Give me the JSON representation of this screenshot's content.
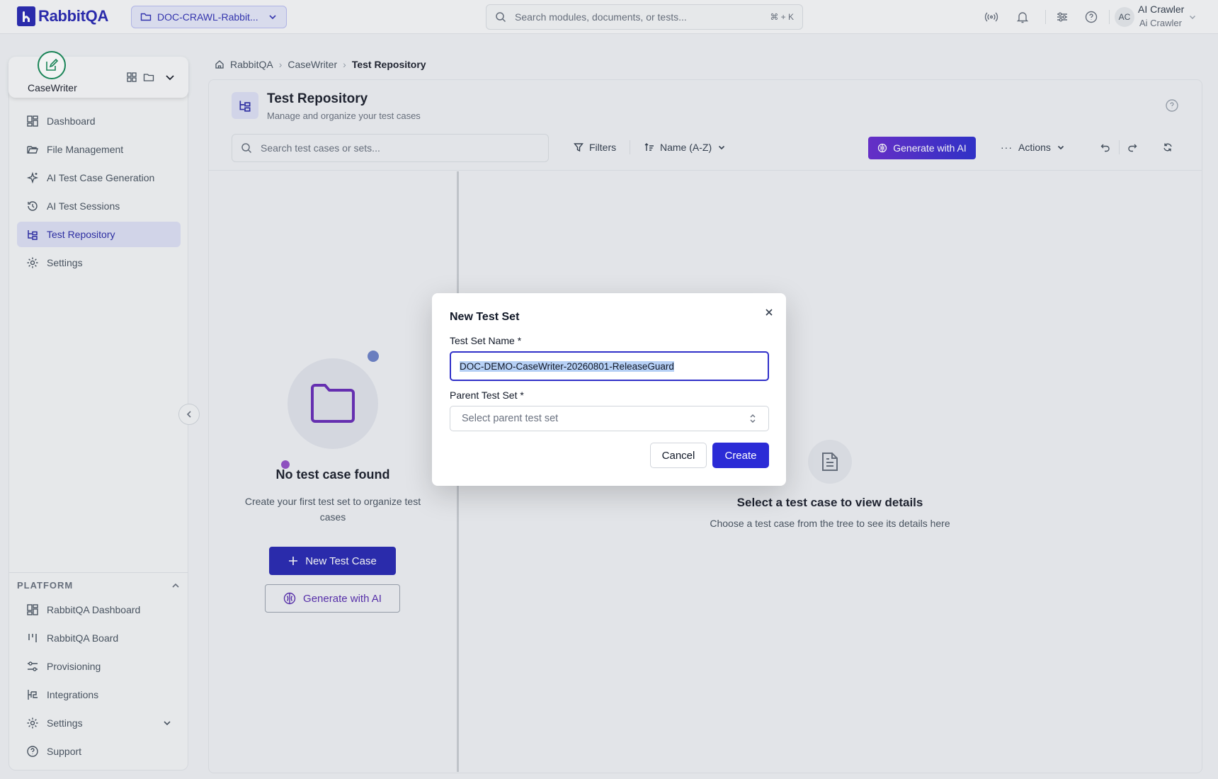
{
  "topbar": {
    "brand": "RabbitQA",
    "project": "DOC-CRAWL-Rabbit...",
    "search_placeholder": "Search modules, documents, or tests...",
    "search_shortcut": "⌘ + K",
    "user_initials": "AC",
    "user_name": "AI Crawler",
    "user_role": "Ai Crawler"
  },
  "sidebar": {
    "module": "CaseWriter",
    "items": [
      {
        "label": "Dashboard"
      },
      {
        "label": "File Management"
      },
      {
        "label": "AI Test Case Generation"
      },
      {
        "label": "AI Test Sessions"
      },
      {
        "label": "Test Repository",
        "active": true
      },
      {
        "label": "Settings"
      }
    ],
    "section_title": "PLATFORM",
    "platform_items": [
      {
        "label": "RabbitQA Dashboard"
      },
      {
        "label": "RabbitQA Board"
      },
      {
        "label": "Provisioning"
      },
      {
        "label": "Integrations"
      },
      {
        "label": "Settings"
      },
      {
        "label": "Support"
      }
    ]
  },
  "breadcrumb": [
    "RabbitQA",
    "CaseWriter",
    "Test Repository"
  ],
  "page": {
    "title": "Test Repository",
    "subtitle": "Manage and organize your test cases"
  },
  "toolbar": {
    "search_placeholder": "Search test cases or sets...",
    "filters": "Filters",
    "sort": "Name (A-Z)",
    "generate": "Generate with AI",
    "actions": "Actions"
  },
  "empty_left": {
    "title": "No test case found",
    "description": "Create your first test set to organize test cases",
    "new_button": "New Test Case",
    "generate_button": "Generate with AI"
  },
  "empty_right": {
    "title": "Select a test case to view details",
    "description": "Choose a test case from the tree to see its details here"
  },
  "modal": {
    "title": "New Test Set",
    "name_label": "Test Set Name *",
    "name_value": "DOC-DEMO-CaseWriter-20260801-ReleaseGuard",
    "parent_label": "Parent Test Set *",
    "parent_placeholder": "Select parent test set",
    "cancel": "Cancel",
    "create": "Create"
  },
  "colors": {
    "brand": "#2b2bb3",
    "active_bg": "#dcdff4",
    "ai_gradient_start": "#6a2fd0",
    "ai_gradient_end": "#3131d0",
    "module_green": "#1a8a5a"
  }
}
